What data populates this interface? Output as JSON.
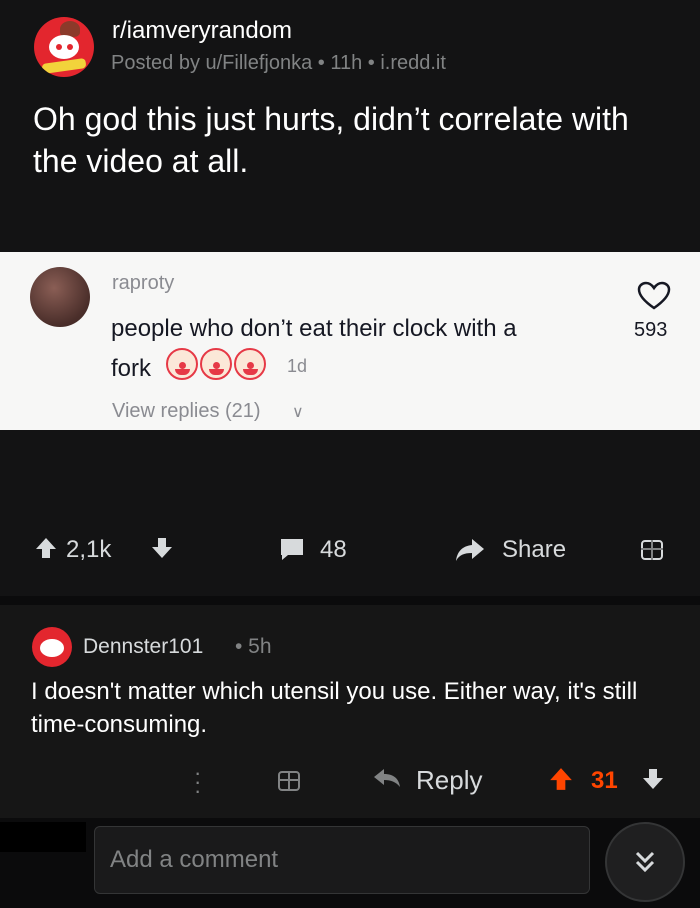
{
  "post": {
    "subreddit": "r/iamveryrandom",
    "meta": "Posted by u/Fillefjonka • 11h • i.redd.it",
    "title": "Oh god this just hurts, didn’t correlate with the video at all."
  },
  "embedded_comment": {
    "username": "raproty",
    "text": "people who don’t eat their clock with a",
    "text_line2": "fork",
    "emoji": [
      "clown-face",
      "clown-face",
      "clown-face"
    ],
    "time": "1d",
    "replies_label": "View replies (21)",
    "likes": "593"
  },
  "post_actions": {
    "score": "2,1k",
    "comments": "48",
    "share_label": "Share"
  },
  "comment": {
    "author": "Dennster101",
    "time": "• 5h",
    "text": "I doesn't matter which utensil you use. Either way, it's still time-consuming.",
    "reply_label": "Reply",
    "score": "31"
  },
  "composer": {
    "placeholder": "Add a comment"
  },
  "colors": {
    "background": "#0b0b0c",
    "card": "#131314",
    "upvote_active": "#ff4500",
    "muted": "#818384",
    "text": "#d7dadc"
  }
}
